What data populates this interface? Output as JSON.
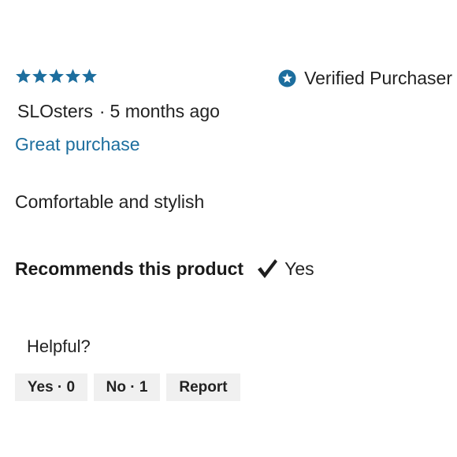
{
  "review": {
    "rating": 5,
    "rating_max": 5,
    "star_color": "#1d6e9e",
    "verified": {
      "icon": "star-badge-icon",
      "label": "Verified Purchaser",
      "icon_color": "#1d6e9e"
    },
    "author": "SLOsters",
    "separator": "·",
    "posted": "5 months ago",
    "title": "Great purchase",
    "title_color": "#1d6e9e",
    "body": "Comfortable and stylish",
    "recommendation": {
      "label": "Recommends this product",
      "icon": "checkmark-icon",
      "answer": "Yes"
    },
    "helpful": {
      "question": "Helpful?",
      "yes_label": "Yes · 0",
      "no_label": "No · 1",
      "report_label": "Report"
    }
  }
}
